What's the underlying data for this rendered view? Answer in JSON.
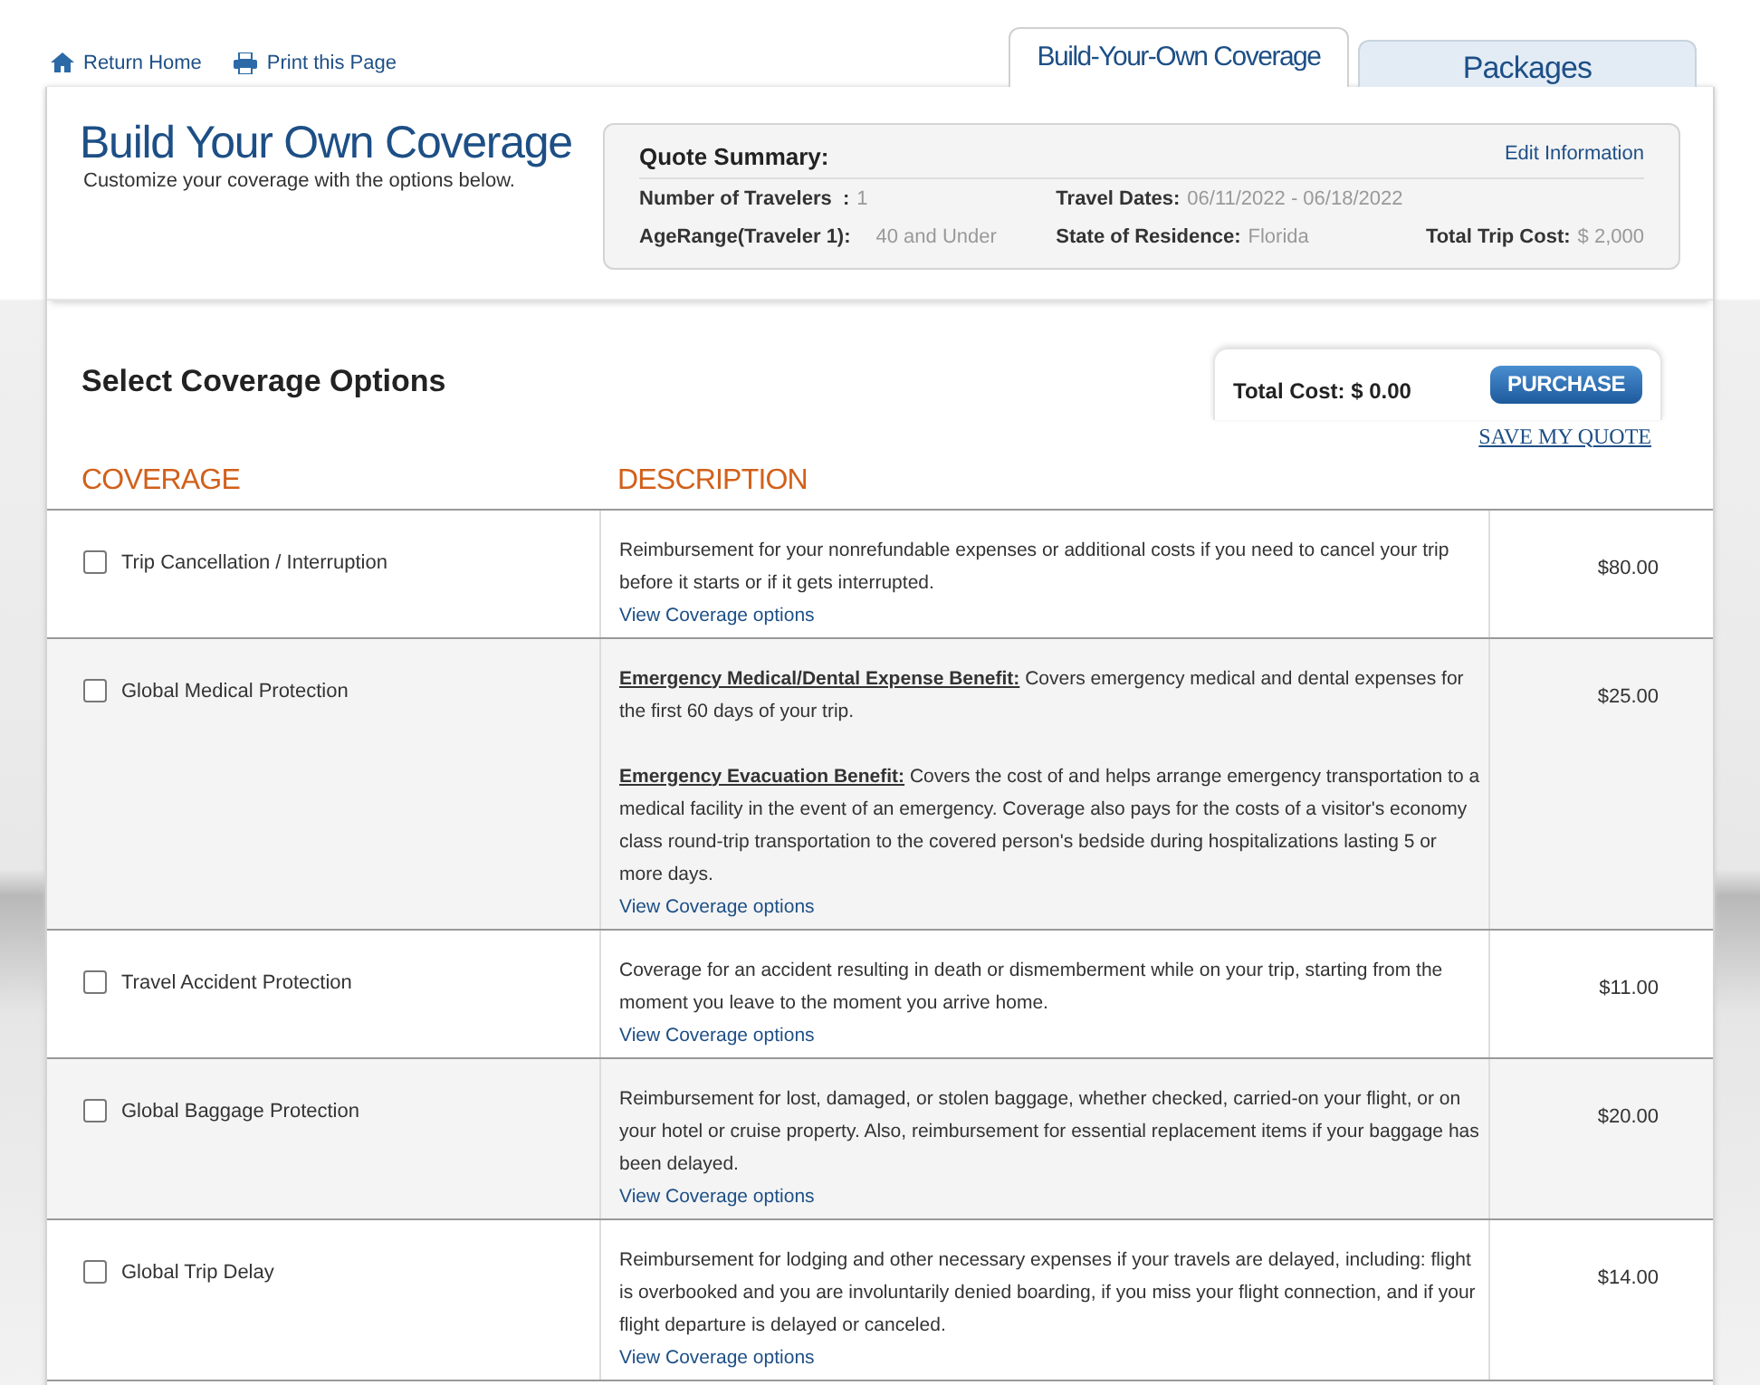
{
  "top_links": [
    {
      "kind": "home",
      "label": "Return Home"
    },
    {
      "kind": "print",
      "label": "Print this Page"
    }
  ],
  "tabs": [
    {
      "label": "Build-Your-Own Coverage",
      "selected": true
    },
    {
      "label": "Packages",
      "selected": false
    }
  ],
  "header": {
    "title": "Build Your Own Coverage",
    "subtitle": "Customize your coverage with the options below."
  },
  "quote_summary": {
    "title": "Quote Summary:",
    "edit_link": "Edit Information",
    "travelers_label": "Number of Travelers  :",
    "travelers": "1",
    "age_label": "AgeRange(Traveler 1):",
    "age": "40 and Under",
    "dates_label": "Travel Dates:",
    "dates": "06/11/2022 - 06/18/2022",
    "state_label": "State of Residence:",
    "state": "Florida",
    "trip_cost_label": "Total Trip Cost:",
    "trip_cost": "$ 2,000"
  },
  "section_title": "Select Coverage Options",
  "total": {
    "label": "Total Cost: $ 0.00",
    "purchase": "PURCHASE",
    "save": "SAVE MY QUOTE"
  },
  "table": {
    "columns": [
      "COVERAGE",
      "DESCRIPTION"
    ],
    "rows": [
      {
        "name": "Trip Cancellation / Interruption",
        "checked": false,
        "paragraphs": [
          {
            "text": "Reimbursement for your nonrefundable expenses or additional costs if you need to cancel your trip before it starts or if it gets interrupted."
          }
        ],
        "link": "View Coverage options",
        "price": "$80.00"
      },
      {
        "name": "Global Medical Protection",
        "checked": false,
        "paragraphs": [
          {
            "heading": "Emergency Medical/Dental Expense Benefit:",
            "text": "Covers emergency medical and dental expenses for the first 60 days of your trip."
          },
          {
            "heading": "Emergency Evacuation Benefit:",
            "text": "Covers the cost of and helps arrange emergency transportation to a medical facility in the event of an emergency. Coverage also pays for the costs of a visitor's economy class round-trip transportation to the covered person's bedside during hospitalizations lasting 5 or more days."
          }
        ],
        "link": "View Coverage options",
        "price": "$25.00"
      },
      {
        "name": "Travel Accident Protection",
        "checked": false,
        "paragraphs": [
          {
            "text": "Coverage for an accident resulting in death or dismemberment while on your trip, starting from the moment you leave to the moment you arrive home."
          }
        ],
        "link": "View Coverage options",
        "price": "$11.00"
      },
      {
        "name": "Global Baggage Protection",
        "checked": false,
        "paragraphs": [
          {
            "text": "Reimbursement for lost, damaged, or stolen baggage, whether checked, carried-on your flight, or on your hotel or cruise property. Also, reimbursement for essential replacement items if your baggage has been delayed."
          }
        ],
        "link": "View Coverage options",
        "price": "$20.00"
      },
      {
        "name": "Global Trip Delay",
        "checked": false,
        "paragraphs": [
          {
            "text": "Reimbursement for lodging and other necessary expenses if your travels are delayed, including: flight is overbooked and you are involuntarily denied boarding, if you miss your flight connection, and if your flight departure is delayed or canceled."
          }
        ],
        "link": "View Coverage options",
        "price": "$14.00"
      }
    ]
  }
}
